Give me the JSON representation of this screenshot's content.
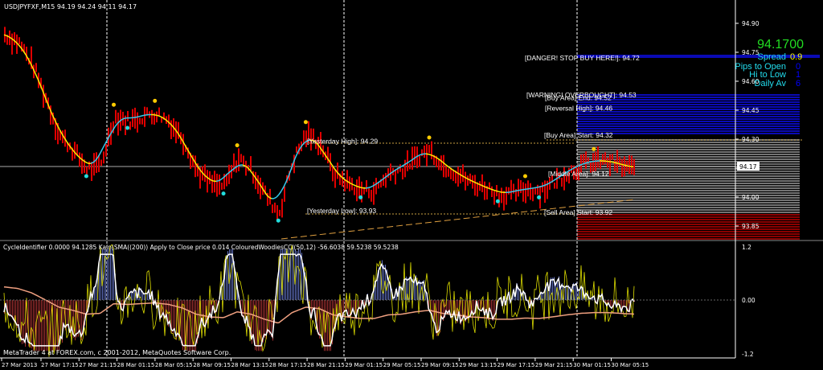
{
  "header": {
    "symbol_info": "USDJPYFXF,M15  94.19 94.24 94.11 94.17"
  },
  "indicator_header": "CycleIdentifier 0.0000 94.1285  Kain(SMA((200)) Apply to Close price 0.014  ColouredWoodiesCCI(50,12) -56.6038 59.5238 59.5238",
  "footer": "MetaTrader 4 at FOREX.com, c 2001-2012, MetaQuotes Software Corp.",
  "info_panel": {
    "price": "94.1700",
    "rows": [
      {
        "label": "Spread",
        "value": "0.9",
        "value_color": "#ffff00"
      },
      {
        "label": "Pips to Open",
        "value": "0",
        "value_color": "#0000ff"
      },
      {
        "label": "Hi to Low",
        "value": "1",
        "value_color": "#0000ff"
      },
      {
        "label": "Daily Av",
        "value": "6",
        "value_color": "#0000ff"
      }
    ]
  },
  "level_labels": [
    {
      "text": "[DANGER! STOP BUY HERE!]: 94.72",
      "price": 94.72
    },
    {
      "text": "[WARNING! OVERBOUGHT]: 94.53",
      "price": 94.53
    },
    {
      "text": "[Buy Area] End: 94.52",
      "price": 94.515
    },
    {
      "text": "[Reversal High]: 94.46",
      "price": 94.46
    },
    {
      "text": "[Buy Area] Start: 94.32",
      "price": 94.32
    },
    {
      "text": "[Middle Area]: 94.12",
      "price": 94.12
    },
    {
      "text": "[Sell Area] Start: 93.92",
      "price": 93.92
    },
    {
      "text": "[Yesterday High]: 94.29",
      "price": 94.29
    },
    {
      "text": "[Yesterday Low]: 93.93",
      "price": 93.93
    }
  ],
  "current_price_tag": "94.17",
  "colors": {
    "bars": "#e00000",
    "ma_up": "#33ccee",
    "ma_down": "#ffee00",
    "buy_zone": "#0a0ab4",
    "sell_zone": "#8b0000",
    "info_price": "#22dd22",
    "info_label": "#22ddee"
  },
  "chart_data": {
    "type": "line",
    "title": "USDJPYFXF,M15",
    "ylim": [
      93.8,
      94.95
    ],
    "y_ticks": [
      "94.90",
      "94.75",
      "94.60",
      "94.45",
      "94.30",
      "94.15",
      "94.00",
      "93.85"
    ],
    "y_tick_values": [
      94.9,
      94.75,
      94.6,
      94.45,
      94.3,
      94.15,
      94.0,
      93.85
    ],
    "x_ticks": [
      "27 Mar 2013",
      "27 Mar 17:15",
      "27 Mar 21:15",
      "28 Mar 01:15",
      "28 Mar 05:15",
      "28 Mar 09:15",
      "28 Mar 13:15",
      "28 Mar 17:15",
      "28 Mar 21:15",
      "29 Mar 01:15",
      "29 Mar 05:15",
      "29 Mar 09:15",
      "29 Mar 13:15",
      "29 Mar 17:15",
      "29 Mar 21:15",
      "30 Mar 01:15",
      "30 Mar 05:15"
    ],
    "close_series": [
      94.85,
      94.81,
      94.7,
      94.52,
      94.33,
      94.25,
      94.15,
      94.17,
      94.42,
      94.4,
      94.42,
      94.44,
      94.4,
      94.31,
      94.15,
      94.08,
      94.06,
      94.21,
      94.15,
      94.02,
      93.92,
      94.19,
      94.33,
      94.29,
      94.13,
      94.08,
      94.04,
      94.04,
      94.13,
      94.15,
      94.21,
      94.25,
      94.17,
      94.13,
      94.08,
      94.06,
      94.02,
      94.02,
      94.05,
      94.04,
      94.08,
      94.13,
      94.17,
      94.19,
      94.19,
      94.17,
      94.15
    ],
    "sub_pane": {
      "y_ticks": [
        "1.2",
        "0.00",
        "-1.2"
      ],
      "y_tick_values": [
        1.2,
        0,
        -1.2
      ]
    }
  }
}
